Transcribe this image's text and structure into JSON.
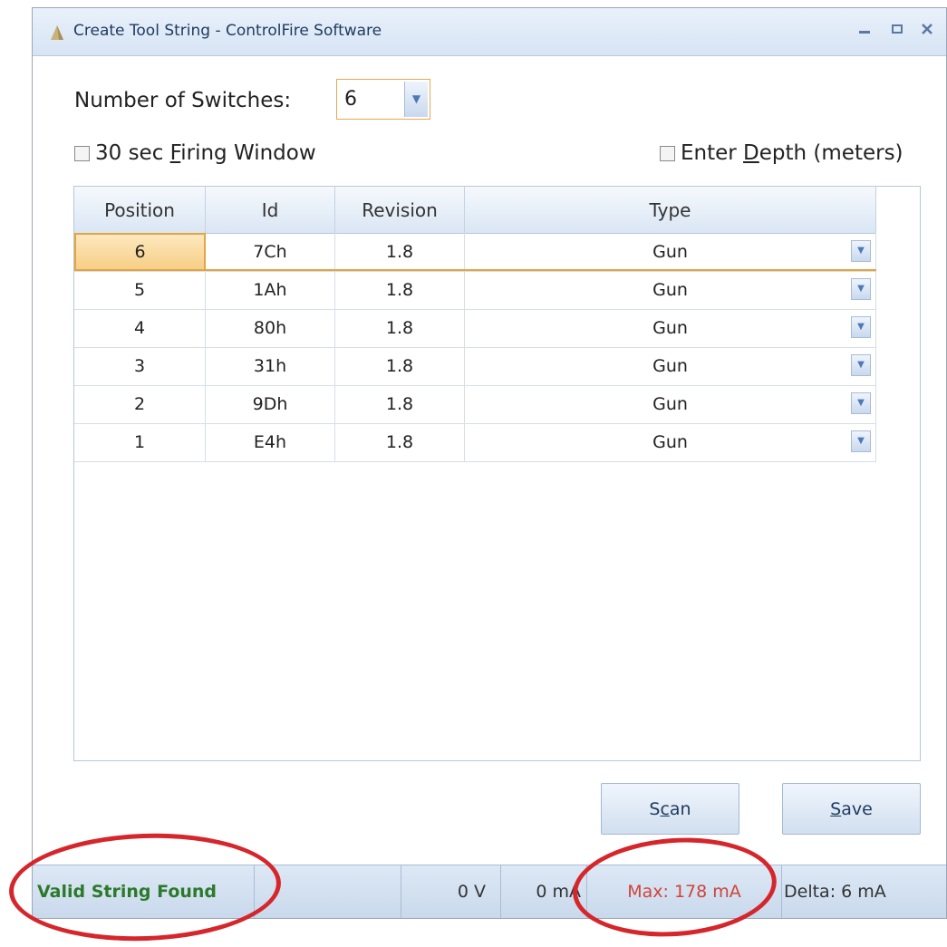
{
  "window": {
    "title": "Create Tool String - ControlFire Software",
    "controls": [
      "minimize-icon",
      "maximize-icon",
      "close-icon"
    ]
  },
  "form": {
    "switches_label": "Number of Switches:",
    "switches_value": "6",
    "firing_window_pre": "30 sec ",
    "firing_window_mnemonic": "F",
    "firing_window_post": "iring Window",
    "firing_window_checked": false,
    "depth_pre": "Enter ",
    "depth_mnemonic": "D",
    "depth_post": "epth (meters)",
    "depth_checked": false
  },
  "grid": {
    "columns": [
      "Position",
      "Id",
      "Revision",
      "Type"
    ],
    "rows": [
      {
        "position": "6",
        "id": "7Ch",
        "revision": "1.8",
        "type": "Gun"
      },
      {
        "position": "5",
        "id": "1Ah",
        "revision": "1.8",
        "type": "Gun"
      },
      {
        "position": "4",
        "id": "80h",
        "revision": "1.8",
        "type": "Gun"
      },
      {
        "position": "3",
        "id": "31h",
        "revision": "1.8",
        "type": "Gun"
      },
      {
        "position": "2",
        "id": "9Dh",
        "revision": "1.8",
        "type": "Gun"
      },
      {
        "position": "1",
        "id": "E4h",
        "revision": "1.8",
        "type": "Gun"
      }
    ]
  },
  "buttons": {
    "scan_pre": "S",
    "scan_mnemonic": "c",
    "scan_post": "an",
    "save_pre": "",
    "save_mnemonic": "S",
    "save_post": "ave"
  },
  "status": {
    "message": "Valid String Found",
    "voltage": "0 V",
    "current": "0 mA",
    "max": "Max: 178 mA",
    "delta": "Delta: 6 mA"
  },
  "colors": {
    "annotation": "#d5262c",
    "valid": "#2b7a2b",
    "max_text": "#d0443a",
    "selection": "#e3a441"
  }
}
